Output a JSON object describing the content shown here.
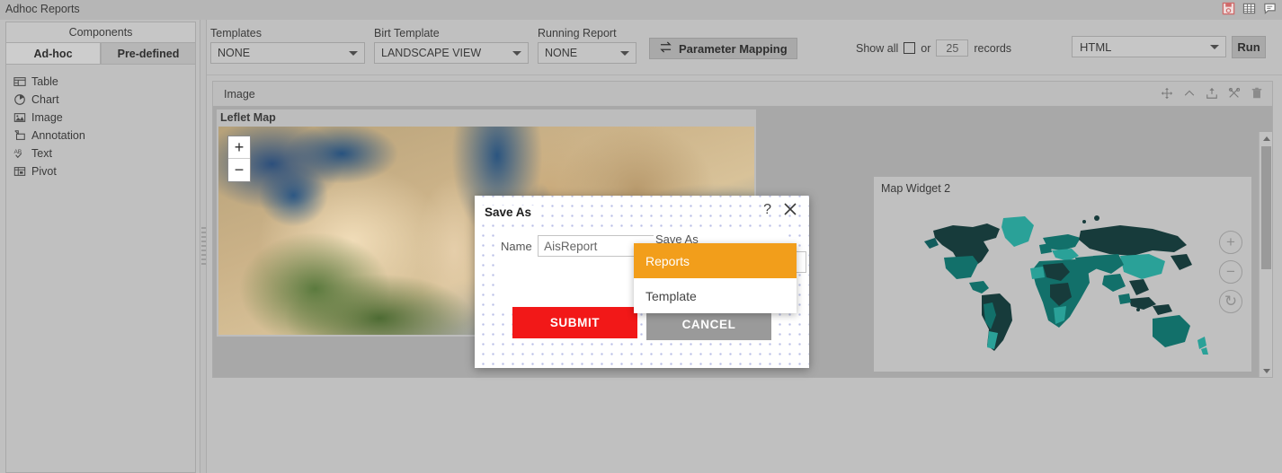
{
  "window": {
    "title": "Adhoc Reports",
    "icons": [
      {
        "name": "save-icon",
        "label": "Save"
      },
      {
        "name": "grid-icon",
        "label": "Grid"
      },
      {
        "name": "comment-icon",
        "label": "Comment"
      }
    ]
  },
  "sidebar": {
    "header": "Components",
    "tabs": [
      {
        "label": "Ad-hoc",
        "active": true
      },
      {
        "label": "Pre-defined",
        "active": false
      }
    ],
    "items": [
      {
        "label": "Table",
        "icon": "table-icon"
      },
      {
        "label": "Chart",
        "icon": "chart-icon"
      },
      {
        "label": "Image",
        "icon": "image-icon"
      },
      {
        "label": "Annotation",
        "icon": "annotation-icon"
      },
      {
        "label": "Text",
        "icon": "text-icon"
      },
      {
        "label": "Pivot",
        "icon": "pivot-icon"
      }
    ]
  },
  "toolbar": {
    "templates": {
      "label": "Templates",
      "value": "NONE"
    },
    "birt_template": {
      "label": "Birt Template",
      "value": "LANDSCAPE VIEW"
    },
    "running_report": {
      "label": "Running Report",
      "value": "NONE"
    },
    "parameter_mapping": {
      "label": "Parameter Mapping",
      "icon": "exchange-icon"
    },
    "show_all": {
      "prefix": "Show all",
      "or": "or",
      "records_value": "25",
      "suffix": "records",
      "checked": false
    },
    "format": {
      "value": "HTML",
      "options": [
        "HTML"
      ]
    },
    "run": {
      "label": "Run"
    }
  },
  "panel": {
    "title": "Image",
    "icons": [
      {
        "name": "move-icon"
      },
      {
        "name": "chevron-up-icon"
      },
      {
        "name": "export-icon"
      },
      {
        "name": "settings-icon"
      },
      {
        "name": "delete-icon"
      }
    ]
  },
  "leaflet_widget": {
    "title": "Leflet Map",
    "zoom_in": "+",
    "zoom_out": "−"
  },
  "map_widget": {
    "title": "Map Widget 2",
    "controls": {
      "zoom_in": "+",
      "zoom_out": "−",
      "reset": "↻"
    },
    "colors": {
      "dark": "#173b3b",
      "mid": "#125c5c",
      "light": "#2aa198"
    }
  },
  "dialog": {
    "title": "Save As",
    "help": "?",
    "close": "✕",
    "name_field": {
      "label": "Name",
      "value": "AisReport"
    },
    "save_as_field": {
      "label": "Save As",
      "value": ""
    },
    "dropdown": {
      "options": [
        {
          "label": "Reports",
          "selected": true
        },
        {
          "label": "Template",
          "selected": false
        }
      ],
      "highlight_color": "#f29e1b"
    },
    "submit": {
      "label": "SUBMIT",
      "color": "#f21818"
    },
    "cancel": {
      "label": "CANCEL",
      "color": "#9a9a9a"
    }
  }
}
